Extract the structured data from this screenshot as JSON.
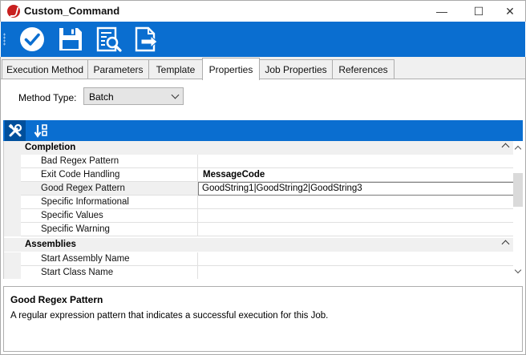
{
  "window": {
    "title": "Custom_Command",
    "minimize": "—",
    "maximize": "☐",
    "close": "✕"
  },
  "toolbar": {
    "buttons": [
      {
        "name": "ok-check-icon"
      },
      {
        "name": "save-disk-icon"
      },
      {
        "name": "preview-search-icon"
      },
      {
        "name": "export-document-icon"
      }
    ]
  },
  "tabs": [
    "Execution Method",
    "Parameters",
    "Template",
    "Properties",
    "Job Properties",
    "References"
  ],
  "active_tab": "Properties",
  "method_type": {
    "label": "Method Type:",
    "value": "Batch"
  },
  "grid_toolbar": {
    "buttons": [
      {
        "name": "categorized-view-icon"
      },
      {
        "name": "alphabetical-sort-icon"
      }
    ]
  },
  "property_grid": {
    "rows": [
      {
        "type": "category",
        "label": "Completion"
      },
      {
        "type": "property",
        "name": "Bad Regex Pattern",
        "value": ""
      },
      {
        "type": "property",
        "name": "Exit Code Handling",
        "value": "MessageCode",
        "bold": true
      },
      {
        "type": "property",
        "name": "Good Regex Pattern",
        "value": "GoodString1|GoodString2|GoodString3",
        "selected": true
      },
      {
        "type": "property",
        "name": "Specific Informational",
        "value": ""
      },
      {
        "type": "property",
        "name": "Specific Values",
        "value": ""
      },
      {
        "type": "property",
        "name": "Specific Warning",
        "value": ""
      },
      {
        "type": "category",
        "label": "Assemblies"
      },
      {
        "type": "property",
        "name": "Start Assembly Name",
        "value": ""
      },
      {
        "type": "property",
        "name": "Start Class Name",
        "value": ""
      }
    ]
  },
  "description": {
    "title": "Good Regex Pattern",
    "text": "A regular expression pattern that indicates a successful execution for this Job."
  }
}
